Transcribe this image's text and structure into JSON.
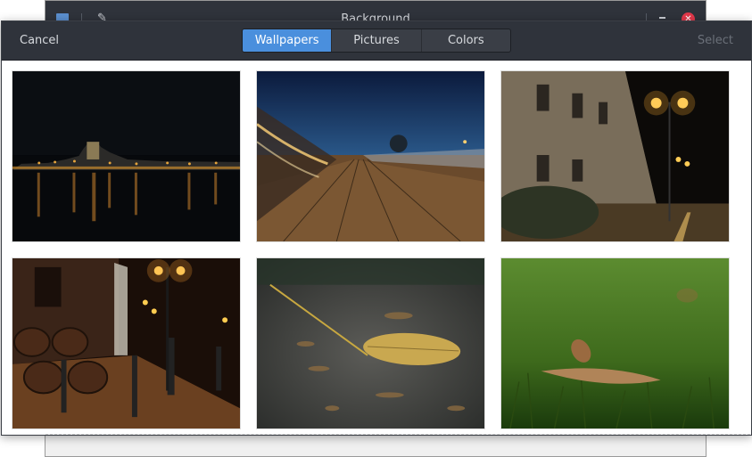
{
  "parent_window": {
    "title": "Background"
  },
  "dialog": {
    "cancel_label": "Cancel",
    "select_label": "Select",
    "tabs": [
      {
        "label": "Wallpapers",
        "active": true
      },
      {
        "label": "Pictures",
        "active": false
      },
      {
        "label": "Colors",
        "active": false
      }
    ]
  },
  "wallpapers": [
    {
      "name": "night-city-riverfront"
    },
    {
      "name": "boardwalk-at-dusk"
    },
    {
      "name": "stone-building-streetlamps"
    },
    {
      "name": "brick-street-barrels"
    },
    {
      "name": "fallen-leaf-on-pavement"
    },
    {
      "name": "leaf-on-grass"
    }
  ],
  "colors": {
    "accent": "#4a8fdd",
    "header_bg": "#2f333b",
    "close": "#e2384a"
  }
}
